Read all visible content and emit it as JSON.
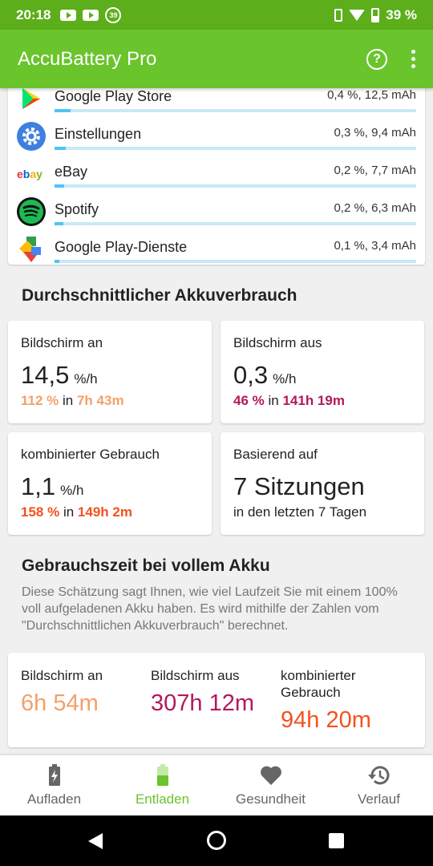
{
  "status_bar": {
    "time": "20:18",
    "notification_badge": "39",
    "battery": "39 %"
  },
  "app_bar": {
    "title": "AccuBattery Pro",
    "help_glyph": "?"
  },
  "apps": [
    {
      "name": "Google Play Store",
      "usage": "0,4 %, 12,5 mAh",
      "bar_fraction": 0.045,
      "icon": "play-store-icon"
    },
    {
      "name": "Einstellungen",
      "usage": "0,3 %, 9,4 mAh",
      "bar_fraction": 0.03,
      "icon": "settings-gear-icon"
    },
    {
      "name": "eBay",
      "usage": "0,2 %, 7,7 mAh",
      "bar_fraction": 0.027,
      "icon": "ebay-icon"
    },
    {
      "name": "Spotify",
      "usage": "0,2 %, 6,3 mAh",
      "bar_fraction": 0.025,
      "icon": "spotify-icon"
    },
    {
      "name": "Google Play-Dienste",
      "usage": "0,1 %, 3,4 mAh",
      "bar_fraction": 0.013,
      "icon": "play-services-icon"
    }
  ],
  "avg_usage": {
    "title": "Durchschnittlicher Akkuverbrauch",
    "screen_on": {
      "label": "Bildschirm an",
      "value": "14,5",
      "unit": "%/h",
      "pct": "112 %",
      "in": "in",
      "duration": "7h 43m",
      "color": "#f4a06a"
    },
    "screen_off": {
      "label": "Bildschirm aus",
      "value": "0,3",
      "unit": "%/h",
      "pct": "46 %",
      "in": "in",
      "duration": "141h 19m",
      "color": "#b0195e"
    },
    "combined": {
      "label": "kombinierter Gebrauch",
      "value": "1,1",
      "unit": "%/h",
      "pct": "158 %",
      "in": "in",
      "duration": "149h 2m",
      "color": "#f4511e"
    },
    "based_on": {
      "label": "Basierend auf",
      "value": "7 Sitzungen",
      "sub": "in den letzten 7 Tagen"
    }
  },
  "full_charge": {
    "title": "Gebrauchszeit bei vollem Akku",
    "description": "Diese Schätzung sagt Ihnen, wie viel Laufzeit Sie mit einem 100% voll aufgeladenen Akku haben. Es wird mithilfe der Zahlen vom \"Durchschnittlichen Akkuverbrauch\" berechnet.",
    "screen_on": {
      "label": "Bildschirm an",
      "value": "6h 54m",
      "color": "#f4a06a"
    },
    "screen_off": {
      "label": "Bildschirm aus",
      "value": "307h 12m",
      "color": "#b0195e"
    },
    "combined": {
      "label": "kombinierter Gebrauch",
      "value": "94h 20m",
      "color": "#f4511e"
    }
  },
  "bottom_nav": {
    "items": [
      {
        "label": "Aufladen",
        "icon": "battery-charging-icon",
        "active": false
      },
      {
        "label": "Entladen",
        "icon": "battery-discharge-icon",
        "active": true
      },
      {
        "label": "Gesundheit",
        "icon": "heart-icon",
        "active": false
      },
      {
        "label": "Verlauf",
        "icon": "history-icon",
        "active": false
      }
    ]
  },
  "colors": {
    "primary": "#6ac42c",
    "statusbar": "#5cae1b",
    "bar": "#4fc3f7"
  }
}
